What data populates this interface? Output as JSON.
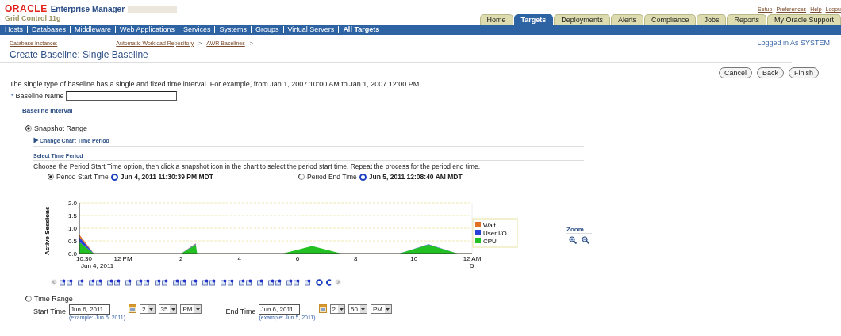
{
  "header": {
    "logo": "ORACLE",
    "product": "Enterprise Manager",
    "subtitle": "Grid Control 11g",
    "global_links": [
      "Setup",
      "Preferences",
      "Help",
      "Logou"
    ],
    "tabs": [
      {
        "label": "Home",
        "selected": false
      },
      {
        "label": "Targets",
        "selected": true
      },
      {
        "label": "Deployments",
        "selected": false
      },
      {
        "label": "Alerts",
        "selected": false
      },
      {
        "label": "Compliance",
        "selected": false
      },
      {
        "label": "Jobs",
        "selected": false
      },
      {
        "label": "Reports",
        "selected": false
      },
      {
        "label": "My Oracle Support",
        "selected": false
      }
    ]
  },
  "nav": [
    {
      "label": "Hosts",
      "selected": false
    },
    {
      "label": "Databases",
      "selected": false
    },
    {
      "label": "Middleware",
      "selected": false
    },
    {
      "label": "Web Applications",
      "selected": false
    },
    {
      "label": "Services",
      "selected": false
    },
    {
      "label": "Systems",
      "selected": false
    },
    {
      "label": "Groups",
      "selected": false
    },
    {
      "label": "Virtual Servers",
      "selected": false
    },
    {
      "label": "All Targets",
      "selected": true
    }
  ],
  "breadcrumb": [
    {
      "label": "Database Instance:"
    },
    {
      "label": "Automatic Workload Repository",
      "separator": ">"
    },
    {
      "label": "AWR Baselines",
      "separator": ">"
    }
  ],
  "logged_in": "Logged in As SYSTEM",
  "page_title": "Create Baseline: Single Baseline",
  "buttons": [
    "Cancel",
    "Back",
    "Finish"
  ],
  "description": "The single type of baseline has a single and fixed time interval. For example, from Jan 1, 2007 10:00 AM to Jan 1, 2007 12:00 PM.",
  "baseline_name": {
    "required_mark": "*",
    "label": "Baseline Name"
  },
  "interval": {
    "heading": "Baseline Interval",
    "options": [
      {
        "label": "Snapshot Range",
        "selected": true
      },
      {
        "label": "Time Range",
        "selected": false
      }
    ]
  },
  "snapshot": {
    "change_link": "Change Chart Time Period",
    "select_heading": "Select Time Period",
    "instructions": "Choose the Period Start Time option, then click a snapshot icon in the chart to select the period start time. Repeat the process for the period end time.",
    "period": [
      {
        "label": "Period Start Time",
        "selected": true,
        "value": "Jun 4, 2011 11:30:39 PM MDT"
      },
      {
        "label": "Period End Time",
        "selected": false,
        "value": "Jun 5, 2011 12:08:40 AM MDT"
      }
    ],
    "chart_data": {
      "type": "area",
      "stacked": true,
      "grid": true,
      "legend": true,
      "ylabel": "Active Sessions",
      "x": [
        -1.5,
        -1,
        2,
        2.5,
        2.55,
        5.5,
        6.5,
        7.5,
        9.5,
        10.5,
        11.5,
        12
      ],
      "series": [
        {
          "name": "Wait",
          "color": "#e07020",
          "values": [
            0.1,
            0,
            0,
            0.02,
            0,
            0,
            0,
            0,
            0,
            0,
            0,
            0
          ]
        },
        {
          "name": "User I/O",
          "color": "#2a3fd8",
          "values": [
            0.2,
            0,
            0,
            0.03,
            0,
            0,
            0,
            0,
            0,
            0.02,
            0,
            0
          ]
        },
        {
          "name": "CPU",
          "color": "#22c022",
          "values": [
            0.45,
            0,
            0,
            0.35,
            0,
            0,
            0.3,
            0,
            0,
            0.35,
            0,
            0
          ]
        }
      ],
      "xlim": [
        -1.5,
        12
      ],
      "ylim": [
        0,
        2
      ],
      "xticks": [
        2,
        4,
        6,
        8,
        10
      ],
      "yticks": [
        {
          "value": 0,
          "label": "0.0"
        },
        {
          "value": 0.5,
          "label": "0.5"
        },
        {
          "value": 1,
          "label": "1.0"
        },
        {
          "value": 1.5,
          "label": "1.5"
        },
        {
          "value": 2,
          "label": "2.0"
        }
      ]
    },
    "x_edge_labels": [
      "10:30",
      "12 PM",
      "12 AM"
    ],
    "x_sublabels": [
      "Jun 4, 2011",
      "5"
    ],
    "zoom_label": "Zoom"
  },
  "time_range": [
    {
      "label": "Start Time",
      "date": "Jun 6, 2011",
      "example": "(example: Jun 5, 2011)",
      "hour": "2",
      "minute": "35",
      "ampm": "PM"
    },
    {
      "label": "End Time",
      "date": "Jun 6, 2011",
      "example": "(example: Jun 5, 2011)",
      "hour": "2",
      "minute": "50",
      "ampm": "PM"
    }
  ]
}
